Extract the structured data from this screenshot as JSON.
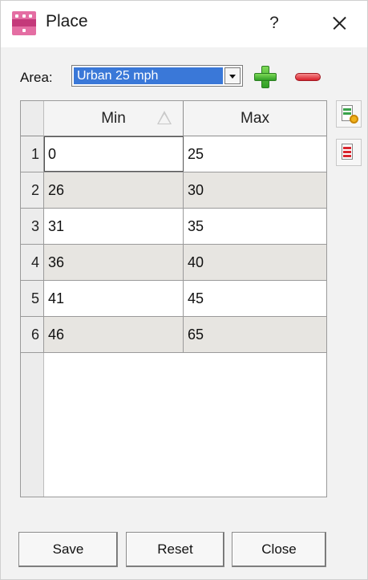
{
  "window": {
    "title": "Place",
    "help_label": "?"
  },
  "area": {
    "label": "Area:",
    "selected": "Urban 25 mph"
  },
  "table": {
    "columns": [
      "Min",
      "Max"
    ],
    "rows": [
      {
        "n": "1",
        "min": "0",
        "max": "25"
      },
      {
        "n": "2",
        "min": "26",
        "max": "30"
      },
      {
        "n": "3",
        "min": "31",
        "max": "35"
      },
      {
        "n": "4",
        "min": "36",
        "max": "40"
      },
      {
        "n": "5",
        "min": "41",
        "max": "45"
      },
      {
        "n": "6",
        "min": "46",
        "max": "65"
      }
    ]
  },
  "buttons": {
    "save": "Save",
    "reset": "Reset",
    "close": "Close"
  },
  "icons": {
    "app": "app-logo-icon",
    "add": "plus-icon",
    "remove": "minus-icon",
    "side1": "document-settings-icon",
    "side2": "document-red-icon",
    "sort": "sort-ascending-icon",
    "close": "close-icon"
  },
  "colors": {
    "selection": "#3a78d8",
    "alt_row": "#e7e5e1",
    "add_green": "#2f9e25",
    "remove_red": "#d81f2a"
  }
}
